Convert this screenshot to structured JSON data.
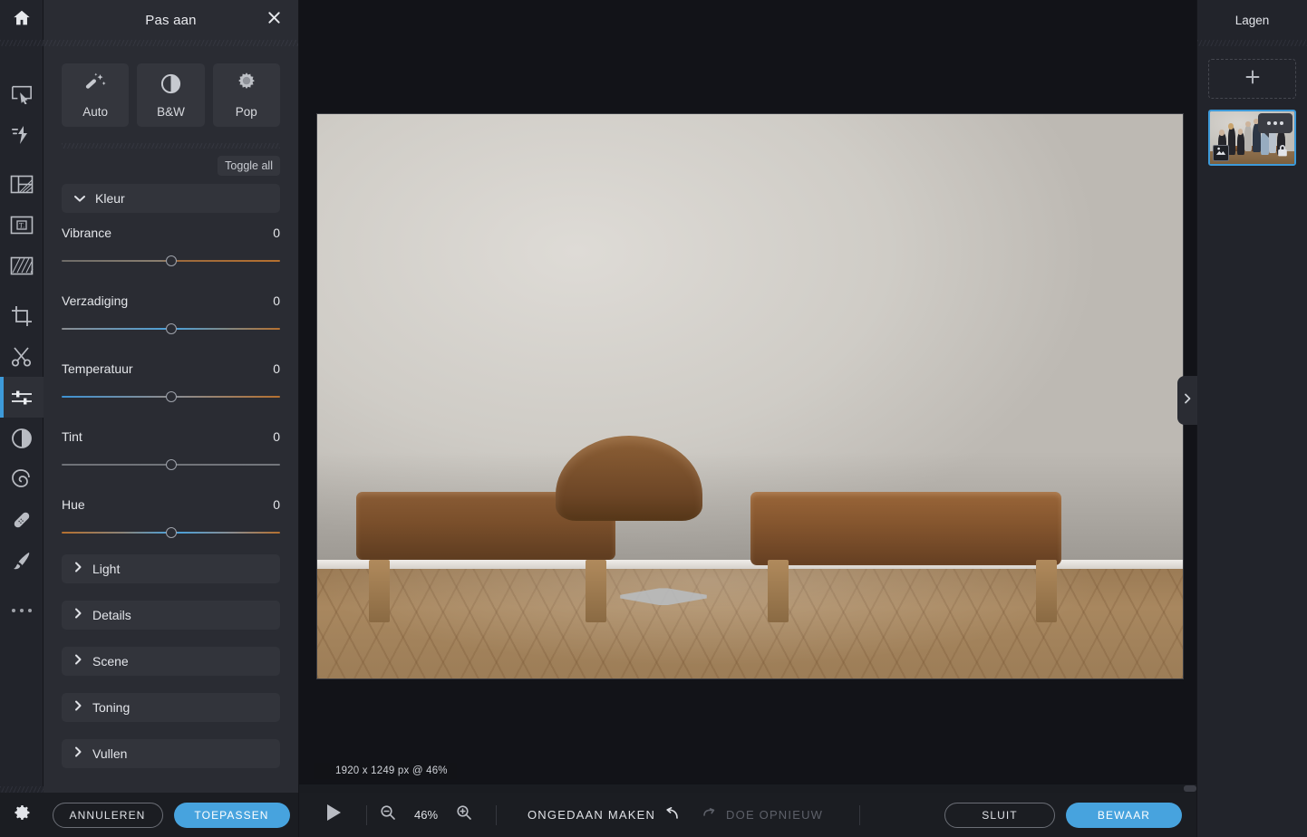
{
  "panel": {
    "title": "Pas aan",
    "close_icon": "close-icon",
    "presets": [
      {
        "label": "Auto",
        "icon": "magic-wand-icon"
      },
      {
        "label": "B&W",
        "icon": "half-circle-contrast-icon"
      },
      {
        "label": "Pop",
        "icon": "sunburst-gear-icon"
      }
    ],
    "toggle_all": "Toggle all",
    "open_section": {
      "label": "Kleur",
      "icon": "chevron-down-icon",
      "expanded": true
    },
    "sliders": [
      {
        "name": "Vibrance",
        "value": "0",
        "track": "t-vibrance",
        "knob_pct": 50
      },
      {
        "name": "Verzadiging",
        "value": "0",
        "track": "t-saturation",
        "knob_pct": 50
      },
      {
        "name": "Temperatuur",
        "value": "0",
        "track": "t-temperature",
        "knob_pct": 50
      },
      {
        "name": "Tint",
        "value": "0",
        "track": "t-tint",
        "knob_pct": 50
      },
      {
        "name": "Hue",
        "value": "0",
        "track": "t-hue",
        "knob_pct": 50
      }
    ],
    "collapsed_sections": [
      {
        "label": "Light",
        "icon": "chevron-right-icon"
      },
      {
        "label": "Details",
        "icon": "chevron-right-icon"
      },
      {
        "label": "Scene",
        "icon": "chevron-right-icon"
      },
      {
        "label": "Toning",
        "icon": "chevron-right-icon"
      },
      {
        "label": "Vullen",
        "icon": "chevron-right-icon"
      }
    ],
    "cancel_label": "ANNULEREN",
    "apply_label": "TOEPASSEN"
  },
  "rail": {
    "home_icon": "home-icon",
    "settings_icon": "gear-icon",
    "tools": [
      {
        "name": "select-tool",
        "icon": "cursor-select-icon",
        "active": false
      },
      {
        "name": "effects-tool",
        "icon": "lightning-bolt-icon",
        "active": false
      },
      {
        "name": "frames-tool",
        "icon": "frames-layout-icon",
        "active": false
      },
      {
        "name": "text-tool",
        "icon": "text-box-icon",
        "active": false
      },
      {
        "name": "overlay-tool",
        "icon": "texture-overlay-icon",
        "active": false
      },
      {
        "name": "crop-tool",
        "icon": "crop-icon",
        "active": false
      },
      {
        "name": "cut-tool",
        "icon": "scissors-icon",
        "active": false
      },
      {
        "name": "adjust-tool",
        "icon": "sliders-icon",
        "active": true
      },
      {
        "name": "contrast-tool",
        "icon": "contrast-circle-icon",
        "active": false
      },
      {
        "name": "swirl-tool",
        "icon": "spiral-swirl-icon",
        "active": false
      },
      {
        "name": "heal-tool",
        "icon": "bandage-heal-icon",
        "active": false
      },
      {
        "name": "brush-tool",
        "icon": "paint-brush-icon",
        "active": false
      },
      {
        "name": "more-tools",
        "icon": "ellipsis-icon",
        "active": false
      }
    ]
  },
  "canvas": {
    "image_info": "1920 x 1249 px @ 46%",
    "play_icon": "play-triangle-icon"
  },
  "toolbar": {
    "zoom_out_icon": "zoom-out-icon",
    "zoom_in_icon": "zoom-in-icon",
    "zoom_level": "46%",
    "undo_label": "ONGEDAAN MAKEN",
    "undo_icon": "undo-arrow-icon",
    "redo_label": "DOE OPNIEUW",
    "redo_icon": "redo-arrow-icon",
    "close_label": "SLUIT",
    "save_label": "BEWAAR"
  },
  "layers": {
    "title": "Lagen",
    "add_icon": "plus-icon",
    "layer": {
      "menu_icon": "ellipsis-menu-icon",
      "image_badge_icon": "image-icon",
      "lock_icon": "lock-icon",
      "selected": true
    },
    "collapse_icon": "chevron-right-icon"
  },
  "colors": {
    "accent": "#47a3de",
    "panel_bg": "#2a2c33",
    "rail_bg": "#22242b",
    "canvas_bg": "#121318",
    "footer_bg": "#1b1d22"
  }
}
